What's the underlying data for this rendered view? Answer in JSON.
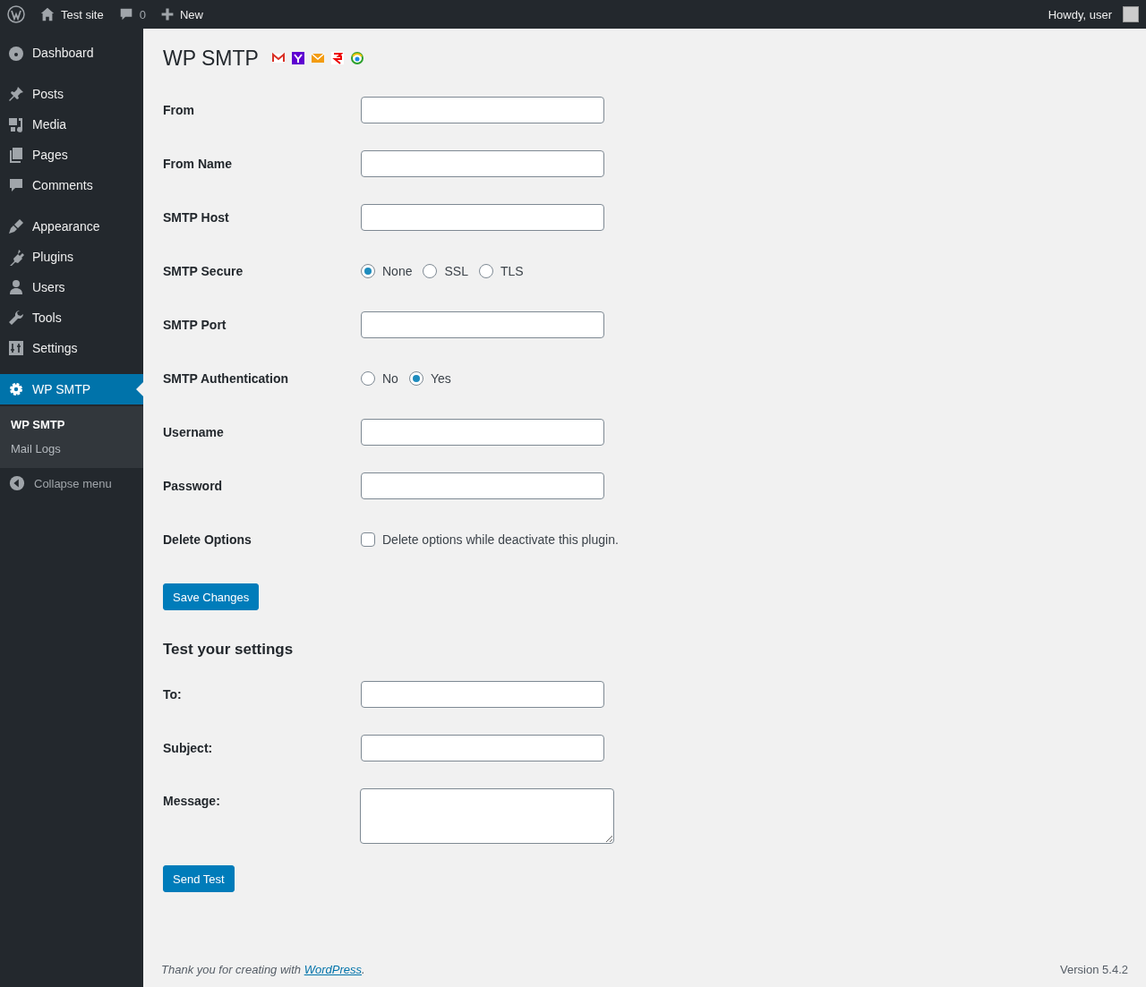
{
  "topbar": {
    "site": "Test site",
    "comments": "0",
    "new": "New",
    "greeting": "Howdy, user"
  },
  "sidebar": {
    "groups": [
      [
        {
          "label": "Dashboard",
          "selected": false
        }
      ],
      [
        {
          "label": "Posts",
          "selected": false
        },
        {
          "label": "Media",
          "selected": false
        },
        {
          "label": "Pages",
          "selected": false
        },
        {
          "label": "Comments",
          "selected": false
        }
      ],
      [
        {
          "label": "Appearance",
          "selected": false
        },
        {
          "label": "Plugins",
          "selected": false
        },
        {
          "label": "Users",
          "selected": false
        },
        {
          "label": "Tools",
          "selected": false
        },
        {
          "label": "Settings",
          "selected": false
        }
      ],
      [
        {
          "label": "WP SMTP",
          "selected": true
        }
      ]
    ],
    "submenu": [
      {
        "label": "WP SMTP",
        "selected": true
      },
      {
        "label": "Mail Logs",
        "selected": false
      }
    ],
    "collapse": "Collapse menu"
  },
  "page": {
    "title": "WP SMTP",
    "fields": [
      {
        "kind": "text",
        "label": "From"
      },
      {
        "kind": "text",
        "label": "From Name"
      },
      {
        "kind": "text",
        "label": "SMTP Host"
      },
      {
        "kind": "radio",
        "label": "SMTP Secure",
        "options": [
          {
            "label": "None",
            "selected": true
          },
          {
            "label": "SSL",
            "selected": false
          },
          {
            "label": "TLS",
            "selected": false
          }
        ]
      },
      {
        "kind": "text",
        "label": "SMTP Port"
      },
      {
        "kind": "radio",
        "label": "SMTP Authentication",
        "options": [
          {
            "label": "No",
            "selected": false
          },
          {
            "label": "Yes",
            "selected": true
          }
        ]
      },
      {
        "kind": "text",
        "label": "Username"
      },
      {
        "kind": "text",
        "label": "Password"
      },
      {
        "kind": "checkbox",
        "label": "Delete Options",
        "checked": false,
        "text": "Delete options while deactivate this plugin."
      }
    ],
    "save": "Save Changes",
    "test_title": "Test your settings",
    "test_fields": [
      {
        "kind": "text",
        "label": "To:"
      },
      {
        "kind": "text",
        "label": "Subject:"
      },
      {
        "kind": "textarea",
        "label": "Message:"
      }
    ],
    "send": "Send Test"
  },
  "footer": {
    "text": "Thank you for creating with ",
    "link": "WordPress",
    "after": ".",
    "version": "Version 5.4.2"
  }
}
